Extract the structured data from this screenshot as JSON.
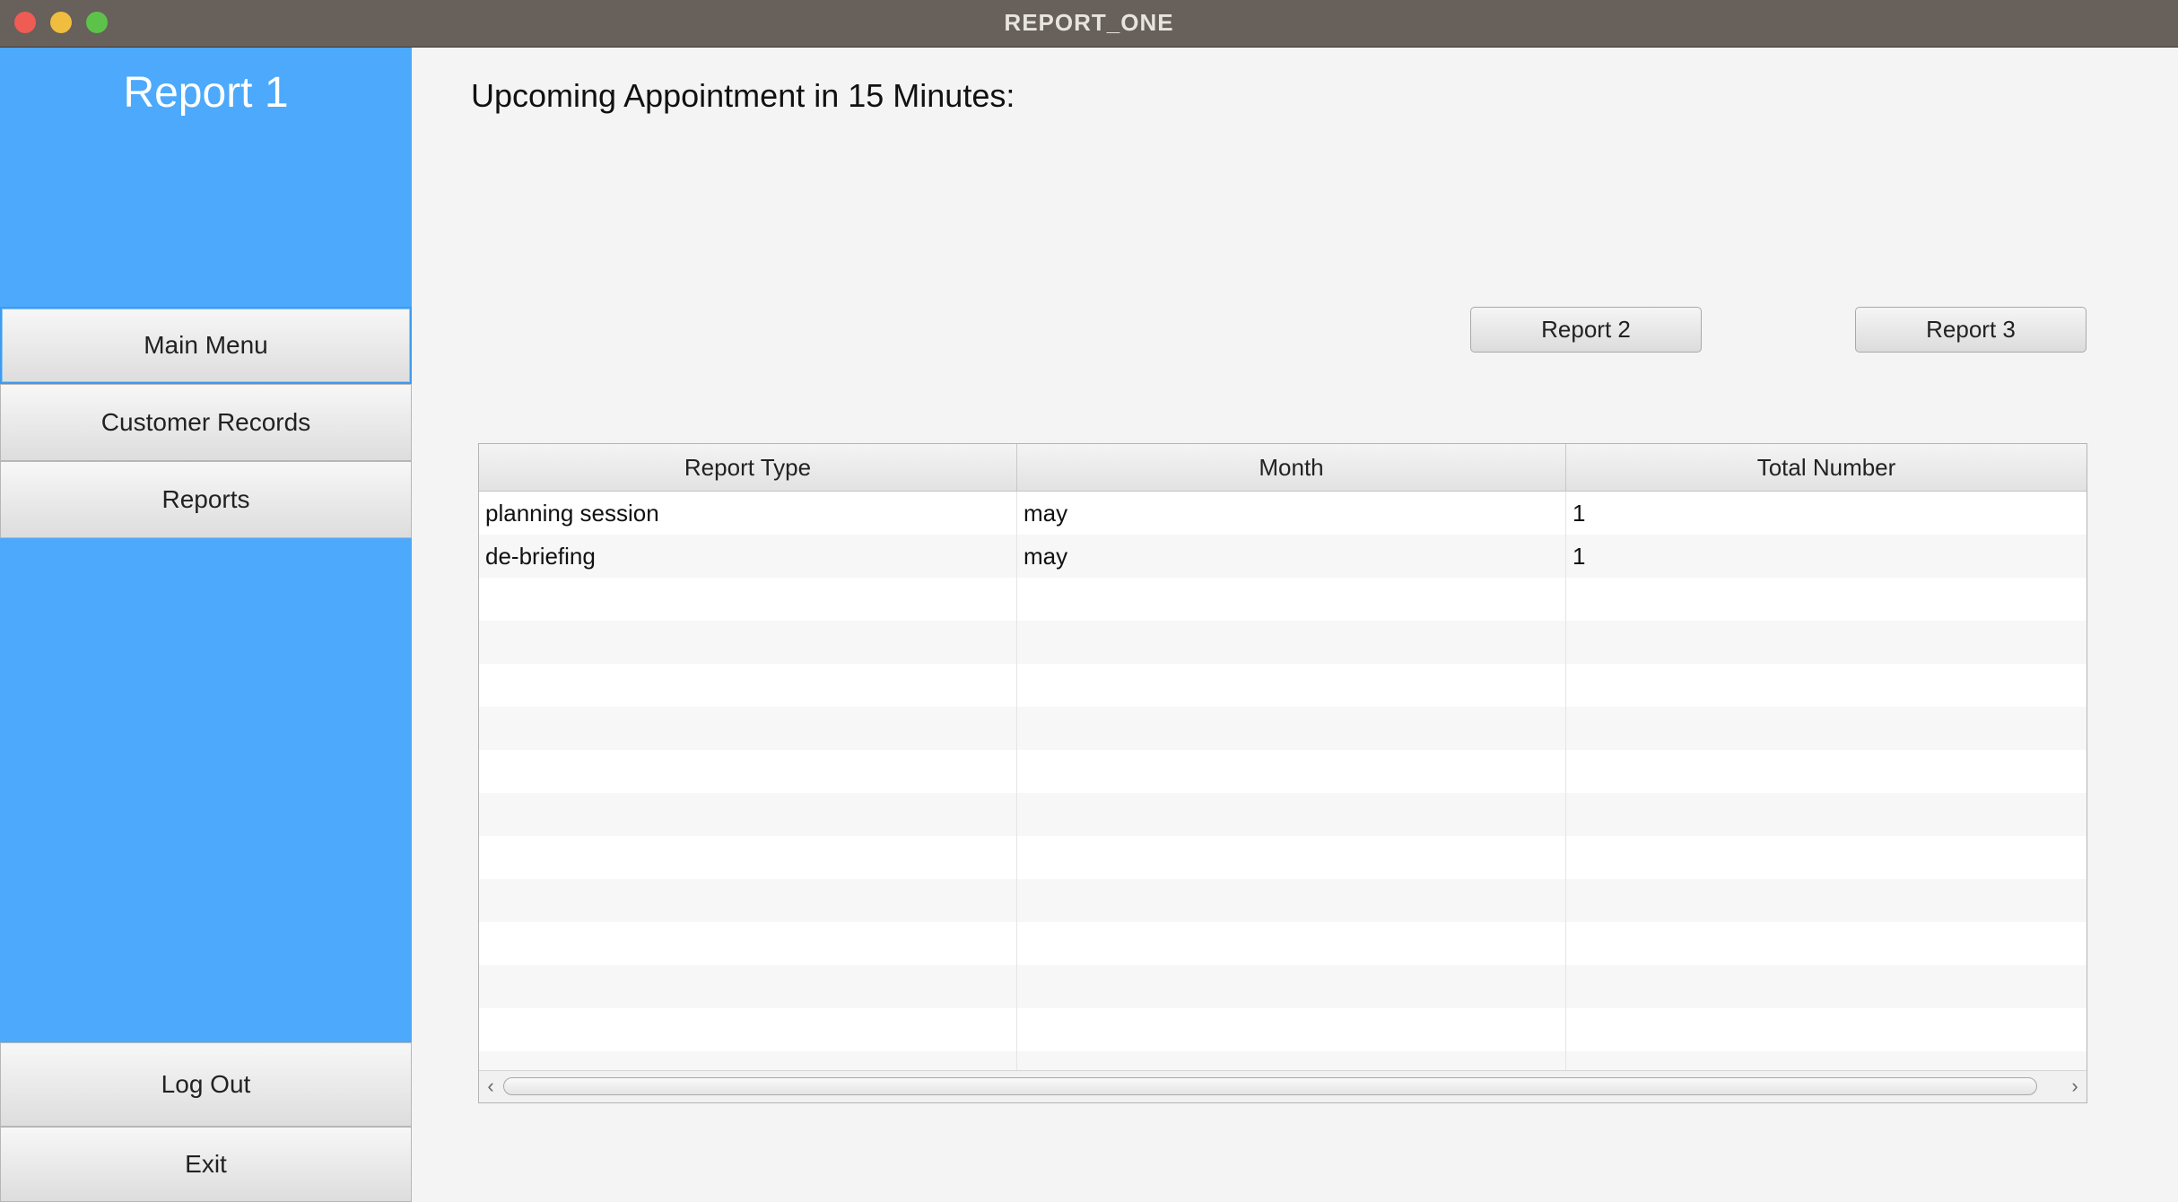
{
  "window": {
    "title": "REPORT_ONE"
  },
  "sidebar": {
    "title": "Report 1",
    "nav": [
      {
        "label": "Main Menu"
      },
      {
        "label": "Customer Records"
      },
      {
        "label": "Reports"
      }
    ],
    "bottom": [
      {
        "label": "Log Out"
      },
      {
        "label": "Exit"
      }
    ],
    "color": "#4ca9fc"
  },
  "main": {
    "heading": "Upcoming Appointment in 15 Minutes:",
    "buttons": {
      "report2": "Report 2",
      "report3": "Report 3"
    }
  },
  "table": {
    "columns": [
      "Report Type",
      "Month",
      "Total Number"
    ],
    "rows": [
      [
        "planning session",
        "may",
        "1"
      ],
      [
        "de-briefing",
        "may",
        "1"
      ]
    ],
    "scroll_left_icon": "chevron-left-icon",
    "scroll_right_icon": "chevron-right-icon"
  },
  "icons": {
    "close": "close-window-icon",
    "minimize": "minimize-window-icon",
    "maximize": "maximize-window-icon"
  }
}
